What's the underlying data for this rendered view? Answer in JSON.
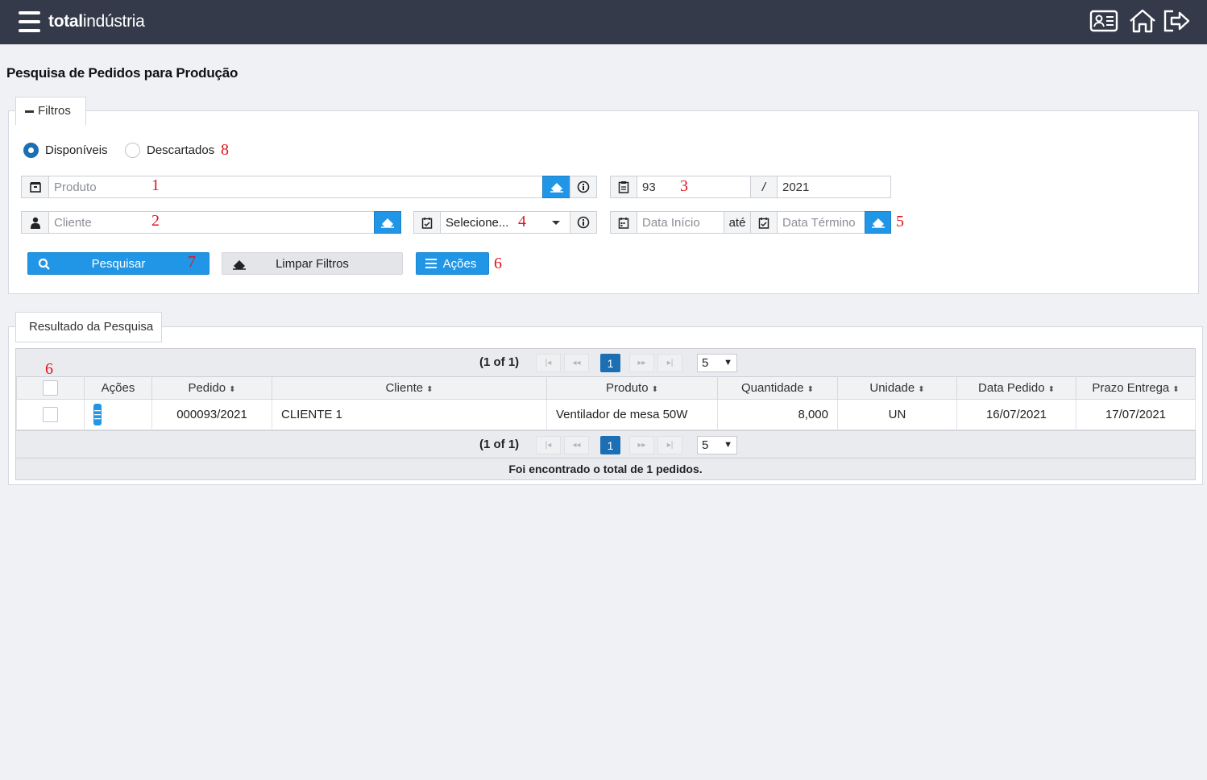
{
  "topbar": {
    "logo_bold": "total",
    "logo_light": "indústria",
    "icons": [
      "profile-card-icon",
      "home-icon",
      "logout-icon"
    ]
  },
  "page": {
    "title": "Pesquisa de Pedidos para Produção"
  },
  "filters": {
    "legend": "Filtros",
    "radio_available": "Disponíveis",
    "radio_discarded": "Descartados",
    "product_placeholder": "Produto",
    "client_placeholder": "Cliente",
    "order_number": "93",
    "order_separator": "/",
    "order_year": "2021",
    "status_select": "Selecione...",
    "date_start_placeholder": "Data Início",
    "date_between": "até",
    "date_end_placeholder": "Data Término",
    "search_button": "Pesquisar",
    "clear_button": "Limpar Filtros",
    "actions_button": "Ações"
  },
  "annotations": {
    "product": "1",
    "client": "2",
    "order": "3",
    "status": "4",
    "dates": "5",
    "actions": "6",
    "search": "7",
    "radios": "8",
    "table_select": "6"
  },
  "results": {
    "legend": "Resultado da Pesquisa",
    "page_info": "(1 of 1)",
    "current_page": "1",
    "rows_per_page": "5",
    "columns": [
      "Ações",
      "Pedido",
      "Cliente",
      "Produto",
      "Quantidade",
      "Unidade",
      "Data Pedido",
      "Prazo Entrega"
    ],
    "rows": [
      {
        "pedido": "000093/2021",
        "cliente": "CLIENTE 1",
        "produto": "Ventilador de mesa 50W",
        "quantidade": "8,000",
        "unidade": "UN",
        "data_pedido": "16/07/2021",
        "prazo_entrega": "17/07/2021"
      }
    ],
    "footer": "Foi encontrado o total de 1 pedidos."
  },
  "colors": {
    "topbar": "#353a4a",
    "primary": "#2196e6",
    "accent_dark": "#1d6fb3",
    "annotation": "#e0141c"
  }
}
